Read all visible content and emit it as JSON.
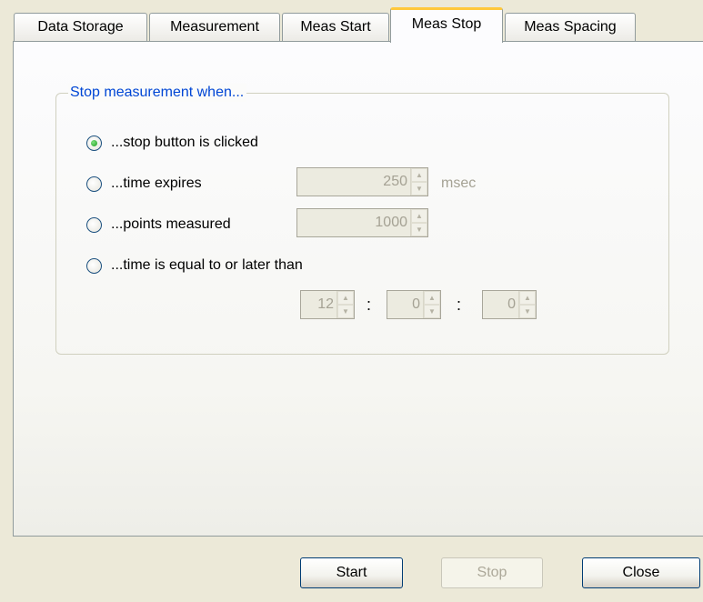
{
  "tabs": [
    {
      "label": "Data Storage"
    },
    {
      "label": "Measurement"
    },
    {
      "label": "Meas Start"
    },
    {
      "label": "Meas Stop",
      "active": true
    },
    {
      "label": "Meas Spacing"
    }
  ],
  "group": {
    "title": "Stop measurement when...",
    "selected_option": "...stop button is clicked",
    "options": [
      {
        "label": "...stop button is clicked"
      },
      {
        "label": "...time expires"
      },
      {
        "label": "...points measured"
      },
      {
        "label": "...time is equal to or later than"
      }
    ],
    "time_expires": {
      "value": "250",
      "unit": "msec"
    },
    "points_measured": {
      "value": "1000"
    },
    "time": {
      "hour": "12",
      "minute": "0",
      "second": "0",
      "separator": ":"
    }
  },
  "buttons": {
    "start": "Start",
    "stop": "Stop",
    "close": "Close"
  },
  "icons": {
    "spin_up": "▲",
    "spin_down": "▼"
  }
}
